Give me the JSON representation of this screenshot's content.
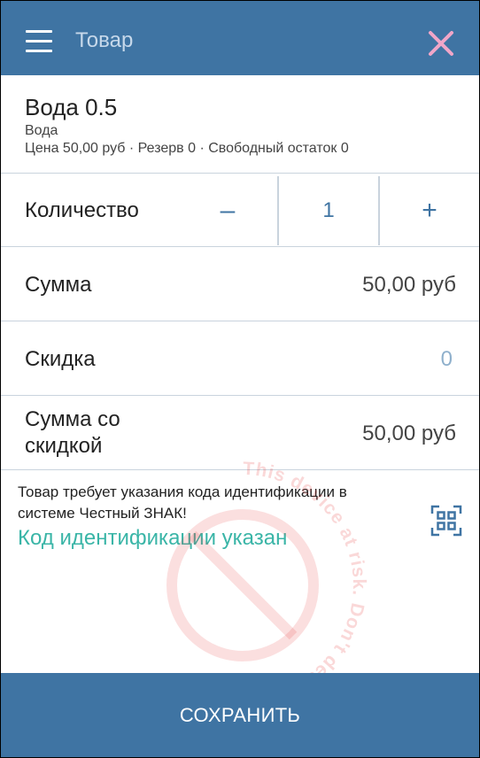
{
  "header": {
    "title": "Товар",
    "menu_icon": "hamburger-icon",
    "close_icon": "close-icon",
    "close_color": "#f0a6c8"
  },
  "product": {
    "name": "Вода 0.5",
    "category": "Вода",
    "info": "Цена 50,00 руб · Резерв 0 · Свободный остаток 0"
  },
  "quantity": {
    "label": "Количество",
    "decrement": "–",
    "value": "1",
    "increment": "+"
  },
  "sum": {
    "label": "Сумма",
    "value": "50,00 руб"
  },
  "discount": {
    "label": "Скидка",
    "value": "0"
  },
  "sum_discounted": {
    "label_line1": "Сумма со",
    "label_line2": "скидкой",
    "value": "50,00 руб"
  },
  "marking": {
    "notice": "Товар требует указания кода идентификации в системе Честный ЗНАК!",
    "status": "Код идентификации указан",
    "scan_icon": "qr-scan-icon"
  },
  "watermark": {
    "text": "This device at risk. Don't deal !",
    "icon": "prohibited-icon"
  },
  "footer": {
    "save_label": "СОХРАНИТЬ"
  },
  "colors": {
    "accent": "#3f74a3",
    "success": "#3ab5a7",
    "muted_value": "#8fb0cc"
  }
}
